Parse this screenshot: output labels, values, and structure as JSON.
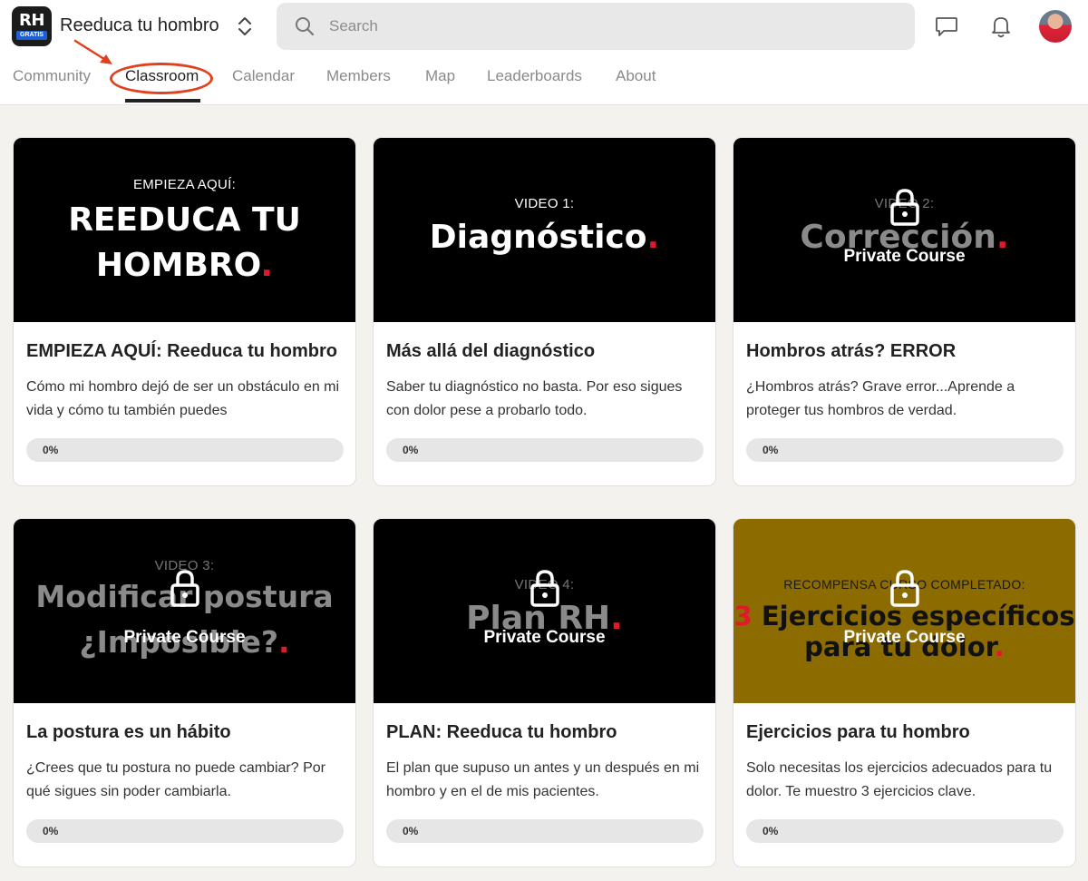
{
  "header": {
    "logo_text": "RH",
    "logo_badge": "GRATIS",
    "group_name": "Reeduca tu hombro",
    "search_placeholder": "Search",
    "icons": [
      "switch-group-icon",
      "search-icon",
      "chat-icon",
      "bell-icon",
      "avatar"
    ]
  },
  "tabs": [
    {
      "label": "Community",
      "active": false
    },
    {
      "label": "Classroom",
      "active": true
    },
    {
      "label": "Calendar",
      "active": false
    },
    {
      "label": "Members",
      "active": false
    },
    {
      "label": "Map",
      "active": false
    },
    {
      "label": "Leaderboards",
      "active": false
    },
    {
      "label": "About",
      "active": false
    }
  ],
  "colors": {
    "accent_dot": "#e01a2b",
    "annotation": "#e0401c",
    "gold_thumb": "#8c6b00"
  },
  "courses": [
    {
      "thumb_small": "EMPIEZA AQUÍ:",
      "thumb_line1": "REEDUCA TU",
      "thumb_line2": "HOMBRO",
      "locked": false,
      "title": "EMPIEZA AQUÍ: Reeduca tu hombro",
      "description": "Cómo mi hombro dejó de ser un obstáculo en mi vida y cómo tu también puedes",
      "progress": 0,
      "progress_label": "0%"
    },
    {
      "thumb_small": "VIDEO 1:",
      "thumb_line1": "Diagnóstico",
      "locked": false,
      "title": "Más allá del diagnóstico",
      "description": "Saber tu diagnóstico no basta. Por eso sigues con dolor pese a probarlo todo.",
      "progress": 0,
      "progress_label": "0%"
    },
    {
      "thumb_small": "VIDEO 2:",
      "thumb_line1": "Corrección",
      "locked": true,
      "lock_label": "Private Course",
      "title": "Hombros atrás? ERROR",
      "description": "¿Hombros atrás? Grave error...Aprende a proteger tus hombros de verdad.",
      "progress": 0,
      "progress_label": "0%"
    },
    {
      "thumb_small": "VIDEO 3:",
      "thumb_line1": "Modificar postura",
      "thumb_line2": "¿Imposible?",
      "locked": true,
      "lock_label": "Private Course",
      "title": "La postura es un hábito",
      "description": "¿Crees que tu postura no puede cambiar? Por qué sigues sin poder cambiarla.",
      "progress": 0,
      "progress_label": "0%"
    },
    {
      "thumb_small": "VIDEO 4:",
      "thumb_line1": "Plan RH",
      "locked": true,
      "lock_label": "Private Course",
      "title": "PLAN: Reeduca tu hombro",
      "description": "El plan que supuso un antes y un después en mi hombro y en el de mis pacientes.",
      "progress": 0,
      "progress_label": "0%"
    },
    {
      "thumb_small": "RECOMPENSA CURSO COMPLETADO:",
      "thumb_line1_num": "3",
      "thumb_line1": "Ejercicios específicos",
      "thumb_line2": "para tu dolor",
      "locked": true,
      "lock_label": "Private Course",
      "title": "Ejercicios para tu hombro",
      "description": "Solo necesitas los ejercicios adecuados para tu dolor. Te muestro 3 ejercicios clave.",
      "progress": 0,
      "progress_label": "0%"
    }
  ]
}
